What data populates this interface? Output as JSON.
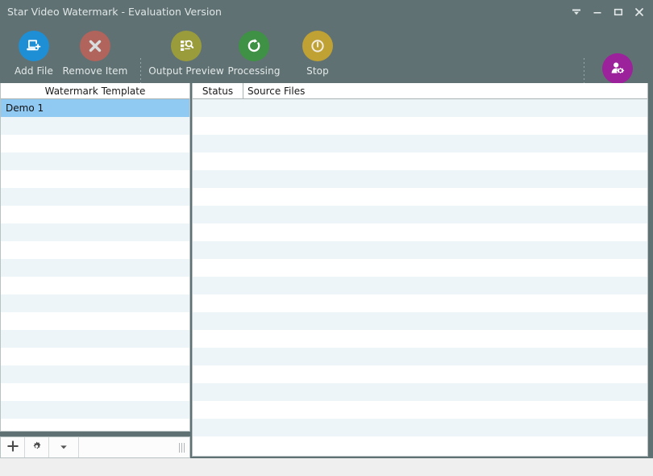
{
  "window": {
    "title": "Star Video Watermark - Evaluation Version",
    "controls": [
      {
        "name": "menu-dropdown",
        "glyph": "chevron-down-icon",
        "label": "Menu"
      },
      {
        "name": "minimize",
        "glyph": "minimize-icon",
        "label": "Minimize"
      },
      {
        "name": "maximize",
        "glyph": "maximize-icon",
        "label": "Maximize"
      },
      {
        "name": "close",
        "glyph": "close-icon",
        "label": "Close"
      }
    ],
    "titlebar_bg": "#607173",
    "title_color": "#dfe6e6"
  },
  "toolbar": {
    "buttons": [
      {
        "id": "add-file",
        "label": "Add File",
        "icon": "add-file-icon",
        "color": "#1e8fd4"
      },
      {
        "id": "remove-item",
        "label": "Remove Item",
        "icon": "remove-item-icon",
        "color": "#b0645c"
      },
      {
        "id": "output-preview",
        "label": "Output Preview",
        "icon": "output-preview-icon",
        "color": "#9a9c3c"
      },
      {
        "id": "processing",
        "label": "Processing",
        "icon": "processing-icon",
        "color": "#3f9145"
      },
      {
        "id": "stop",
        "label": "Stop",
        "icon": "stop-icon",
        "color": "#bfa134"
      },
      {
        "id": "preferences",
        "label": "Preferences",
        "icon": "preferences-icon",
        "color": "#9c229c"
      }
    ]
  },
  "left_panel": {
    "header": "Watermark Template",
    "selected_index": 0,
    "items": [
      {
        "label": "Demo 1"
      }
    ],
    "empty_row_count": 18,
    "selected_bg": "#90c9f2",
    "stripe_bg": "#edf5f8"
  },
  "left_footer": {
    "add_button": "+",
    "settings_button": "gear-icon",
    "dropdown_button": "chevron-down-icon",
    "resize_grip": "resize-grip-icon"
  },
  "right_panel": {
    "columns": [
      "Status",
      "Source Files"
    ],
    "rows": [],
    "empty_row_count": 20,
    "stripe_bg": "#edf5f8"
  }
}
